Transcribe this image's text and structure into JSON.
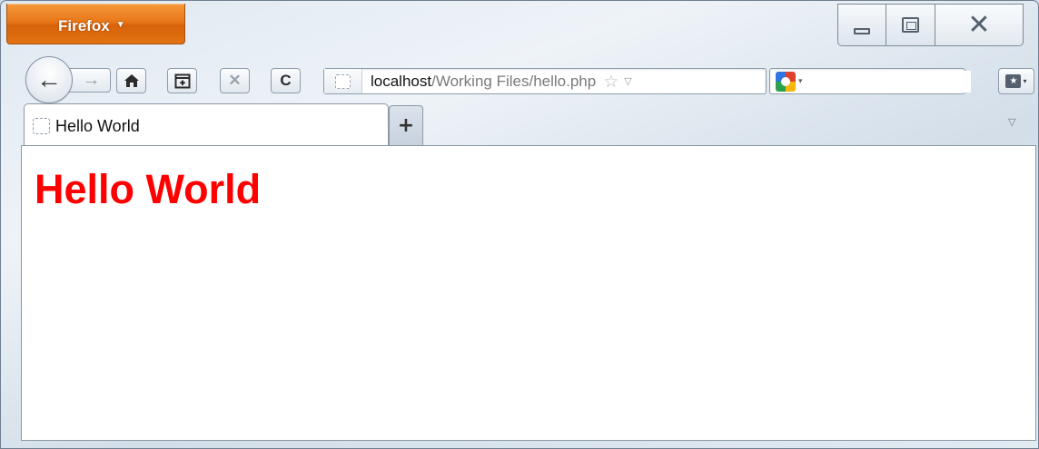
{
  "app": {
    "menu_button_label": "Firefox",
    "menu_arrow": "▼"
  },
  "window_controls": {
    "minimize_icon": "minimize-icon",
    "maximize_icon": "maximize-icon",
    "close_icon": "close-icon",
    "close_glyph": "✕"
  },
  "toolbar": {
    "back_glyph": "←",
    "forward_glyph": "→",
    "home_icon": "home-icon",
    "panorama_icon": "panorama-icon",
    "stop_glyph": "✕",
    "reload_glyph": "C"
  },
  "urlbar": {
    "host": "localhost",
    "path": "/Working Files/hello.php",
    "star_glyph": "☆",
    "dropdown_glyph": "▽"
  },
  "searchbar": {
    "engine_icon": "google-icon",
    "engine_arrow": "▾",
    "value": "",
    "go_glyph": "⚲"
  },
  "bookmarks_button": {
    "icon": "bookmarks-icon",
    "arrow": "▾"
  },
  "tabs": [
    {
      "title": "Hello World",
      "active": true
    }
  ],
  "new_tab_glyph": "+",
  "tab_list_glyph": "▽",
  "page": {
    "heading": "Hello World",
    "heading_color": "#ff0000"
  },
  "colors": {
    "app_button": "#e8781a",
    "heading": "#ff0000"
  }
}
